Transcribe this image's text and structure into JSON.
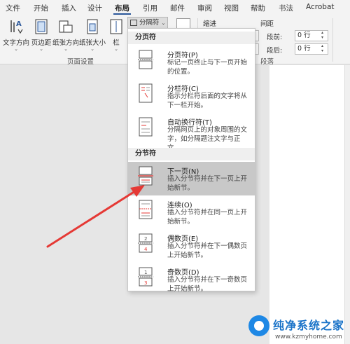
{
  "tabs": [
    "文件",
    "开始",
    "插入",
    "设计",
    "布局",
    "引用",
    "邮件",
    "审阅",
    "视图",
    "帮助",
    "书法",
    "Acrobat"
  ],
  "active_tab": "布局",
  "ribbon": {
    "buttons": {
      "text_direction": "文字方向",
      "margins": "页边距",
      "orientation": "纸张方向",
      "size": "纸张大小",
      "columns": "栏"
    },
    "breaks_button": "分隔符",
    "page_setup_label": "页面设置",
    "indent_label": "缩进",
    "spacing_label": "间距",
    "spacing_before_label": "段前:",
    "spacing_after_label": "段后:",
    "spacing_before_value": "0 行",
    "spacing_after_value": "0 行",
    "paragraph_label": "段落"
  },
  "menu": {
    "page_breaks_header": "分页符",
    "section_breaks_header": "分节符",
    "items": [
      {
        "title": "分页符(P)",
        "desc": "标记一页终止与下一页开始的位置。"
      },
      {
        "title": "分栏符(C)",
        "desc": "指示分栏符后面的文字将从下一栏开始。"
      },
      {
        "title": "自动换行符(T)",
        "desc": "分隔网页上的对象周围的文字，如分隔题注文字与正文。"
      },
      {
        "title": "下一页(N)",
        "desc": "插入分节符并在下一页上开始新节。"
      },
      {
        "title": "连续(O)",
        "desc": "插入分节符并在同一页上开始新节。"
      },
      {
        "title": "偶数页(E)",
        "desc": "插入分节符并在下一偶数页上开始新节。"
      },
      {
        "title": "奇数页(D)",
        "desc": "插入分节符并在下一奇数页上开始新节。"
      }
    ]
  },
  "watermark": {
    "title": "纯净系统之家",
    "url": "www.kzmyhome.com"
  },
  "colors": {
    "arrow": "#e53935",
    "accent": "#2b579a",
    "highlight": "#c8c8c8"
  }
}
